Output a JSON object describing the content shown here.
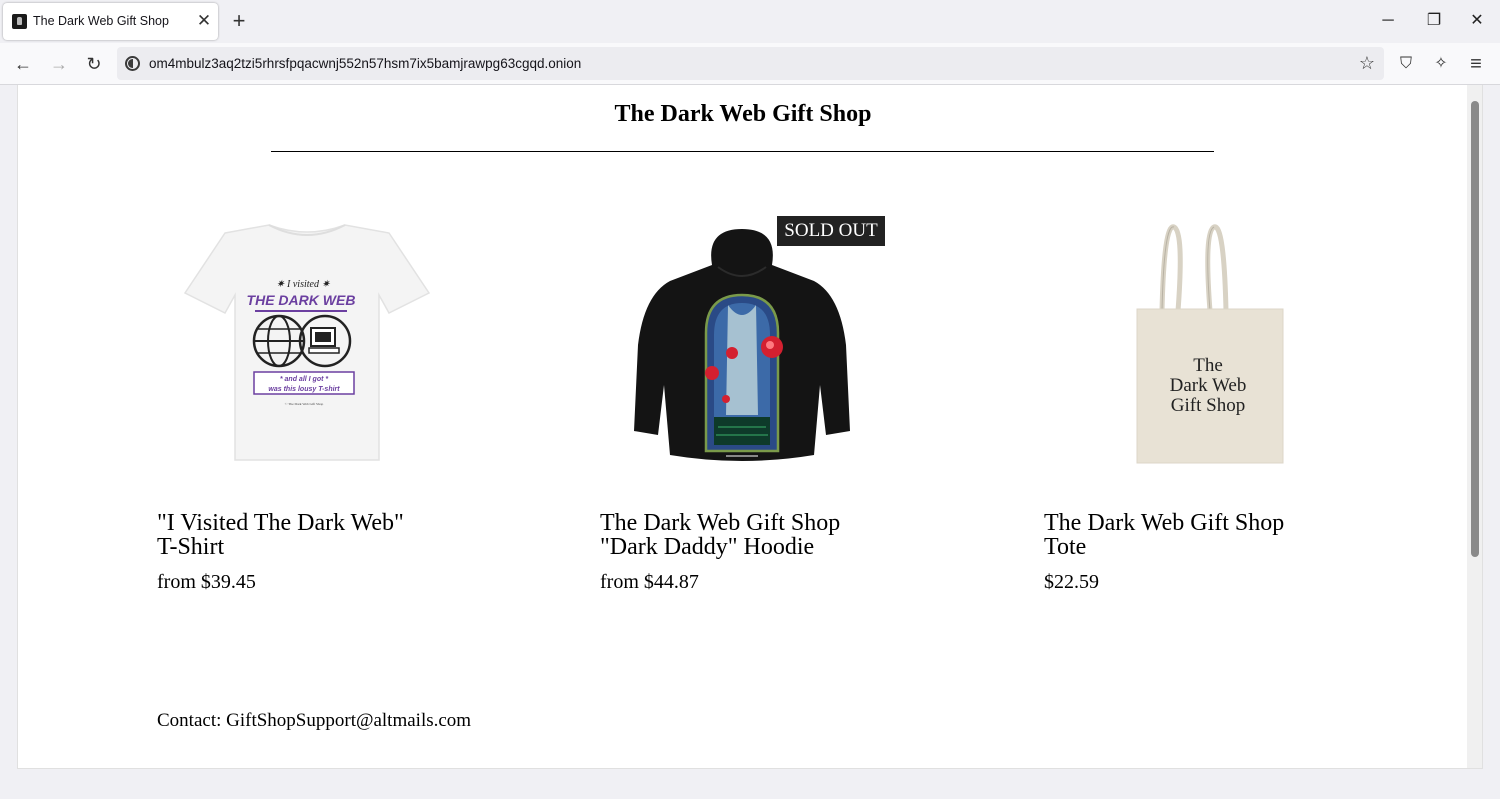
{
  "browser": {
    "tab_title": "The Dark Web Gift Shop",
    "tab_close": "✕",
    "new_tab": "+",
    "url": "om4mbulz3aq2tzi5rhrsfpqacwnj552n57hsm7ix5bamjrawpg63cgqd.onion",
    "window_controls": {
      "minimize": "─",
      "restore": "❐",
      "close": "✕"
    },
    "nav": {
      "back": "←",
      "forward": "→",
      "reload": "↻"
    },
    "tools": {
      "bookmark": "☆",
      "shield": "⛉",
      "extensions": "✧",
      "menu": "≡"
    }
  },
  "page": {
    "title": "The Dark Web Gift Shop",
    "products": [
      {
        "name_line1": "\"I Visited The Dark Web\"",
        "name_line2": "T-Shirt",
        "price": "from $39.45",
        "image": {
          "item": "t-shirt",
          "print_top": "✷ I visited ✷",
          "print_headline": "THE DARK WEB",
          "print_box_line1": "* and all I got *",
          "print_box_line2": "was this lousy T-shirt",
          "print_footer": "© The Dark Web Gift Shop"
        }
      },
      {
        "name_line1": "The Dark Web Gift Shop",
        "name_line2": "\"Dark Daddy\" Hoodie",
        "price": "from $44.87",
        "badge": "SOLD OUT",
        "image": {
          "item": "hoodie"
        }
      },
      {
        "name_line1": "The Dark Web Gift Shop",
        "name_line2": "Tote",
        "price": "$22.59",
        "image": {
          "item": "tote",
          "print_line1": "The",
          "print_line2": "Dark Web",
          "print_line3": "Gift Shop"
        }
      }
    ],
    "contact": "Contact: GiftShopSupport@altmails.com"
  },
  "colors": {
    "tab_bg": "#ffffff",
    "chrome_bg": "#f0f0f4",
    "url_bg": "#ececf0",
    "page_bg": "#ffffff",
    "badge_bg": "#222222",
    "shirt_print": "#6b3fa0",
    "hoodie": "#141414",
    "tote": "#e8e2d5"
  }
}
